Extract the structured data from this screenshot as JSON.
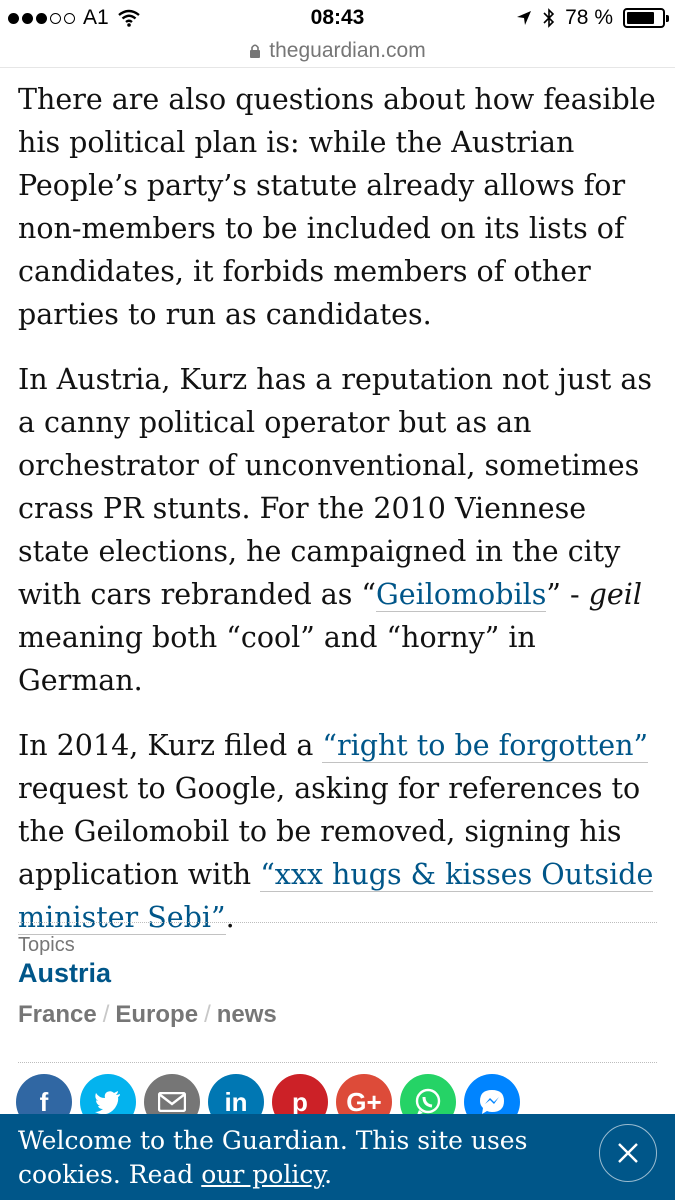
{
  "status_bar": {
    "carrier": "A1",
    "time": "08:43",
    "battery": "78 %",
    "signal_strength": "3/5",
    "battery_level": 0.78
  },
  "url_bar": {
    "domain": "theguardian.com"
  },
  "article": {
    "p1": "There are also questions about how feasible his political plan is: while the Austrian People’s party’s statute already allows for non-members to be included on its lists of candidates, it forbids members of other parties to run as candidates.",
    "p2_text": "In Austria, Kurz has a reputation not just as a canny political operator but as an orchestrator of unconventional, sometimes crass PR stunts. For the 2010 Viennese state elections, he campaigned in the city with cars rebranded as “",
    "p2_link": "Geilomobils",
    "p2_mid": "” - ",
    "p2_em": "geil",
    "p2_end": " meaning both “cool” and “horny” in German.",
    "p3_start": "In 2014, Kurz filed a ",
    "p3_link1": "“right to be forgotten”",
    "p3_mid": " request to Google, asking for references to the Geilomobil to be removed, signing his application with ",
    "p3_link2": "“xxx hugs & kisses Outside minister Sebi”",
    "p3_end": "."
  },
  "topics": {
    "label": "Topics",
    "main": "Austria",
    "related": [
      "France",
      "Europe",
      "news"
    ]
  },
  "share": {
    "buttons": [
      {
        "name": "facebook",
        "glyph": "f",
        "color": "#3067a3"
      },
      {
        "name": "twitter",
        "glyph": "t",
        "color": "#03b3ee"
      },
      {
        "name": "email",
        "glyph": "✉",
        "color": "#767676"
      },
      {
        "name": "linkedin",
        "glyph": "in",
        "color": "#0077b3"
      },
      {
        "name": "pinterest",
        "glyph": "p",
        "color": "#cc2127"
      },
      {
        "name": "google-plus",
        "glyph": "G+",
        "color": "#dd4b39"
      },
      {
        "name": "whatsapp",
        "glyph": "w",
        "color": "#25d366"
      },
      {
        "name": "messenger",
        "glyph": "m",
        "color": "#0084ff"
      }
    ]
  },
  "cookie_banner": {
    "text": "Welcome to the Guardian. This site uses cookies. Read ",
    "link": "our policy",
    "end": "."
  },
  "colors": {
    "accent": "#005689",
    "banner_bg": "#005689"
  }
}
